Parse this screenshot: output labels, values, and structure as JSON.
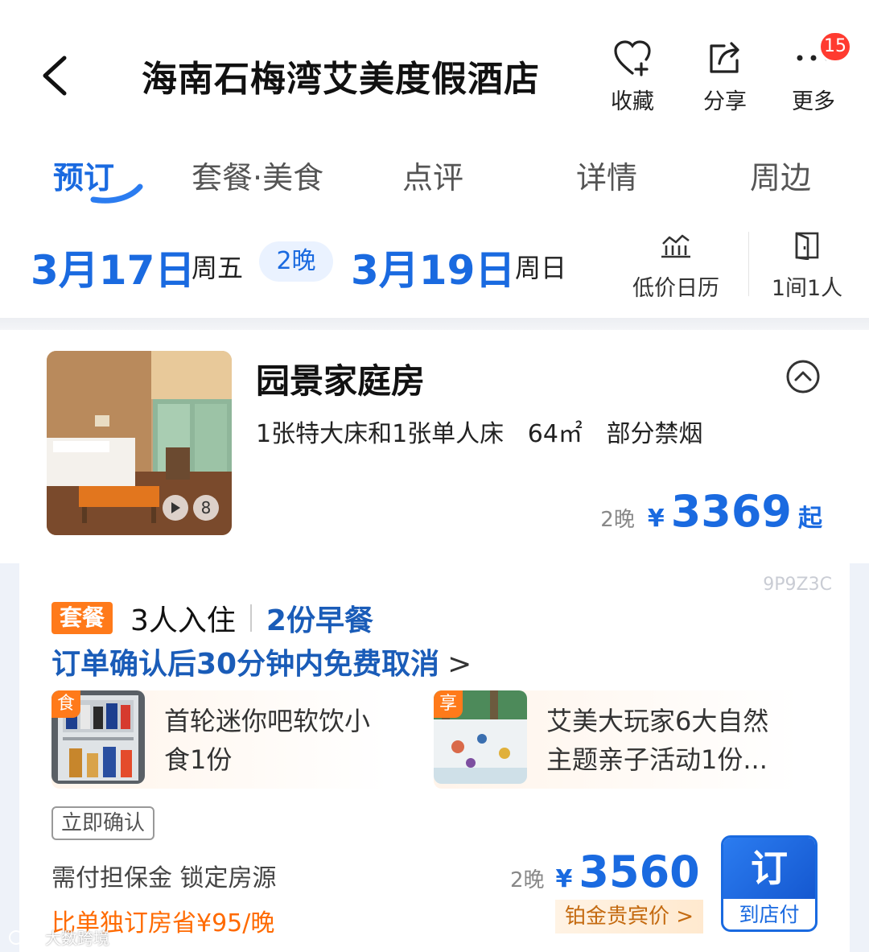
{
  "header": {
    "title": "海南石梅湾艾美度假酒店",
    "actions": [
      {
        "label": "收藏",
        "icon": "heart-plus-icon"
      },
      {
        "label": "分享",
        "icon": "share-icon"
      },
      {
        "label": "更多",
        "icon": "more-icon"
      }
    ],
    "badge_count": "15"
  },
  "tabs": [
    {
      "label": "预订",
      "active": true
    },
    {
      "label": "套餐·美食",
      "active": false
    },
    {
      "label": "点评",
      "active": false
    },
    {
      "label": "详情",
      "active": false
    },
    {
      "label": "周边",
      "active": false
    }
  ],
  "dates": {
    "checkin": "3月17日",
    "checkin_week": "周五",
    "nights": "2晚",
    "checkout": "3月19日",
    "checkout_week": "周日"
  },
  "tools": [
    {
      "label": "低价日历",
      "icon": "price-chart-icon"
    },
    {
      "label": "1间1人",
      "icon": "door-icon"
    }
  ],
  "room": {
    "name": "园景家庭房",
    "specs": [
      "1张特大床和1张单人床",
      "64㎡",
      "部分禁烟"
    ],
    "photo_count": "8",
    "price_nights": "2晚",
    "currency": "¥",
    "price": "3369",
    "price_suffix": "起"
  },
  "package": {
    "code": "9P9Z3C",
    "tag": "套餐",
    "guests": "3人入住",
    "breakfast": "2份早餐",
    "cancel_policy": "订单确认后30分钟内免费取消",
    "perks": [
      {
        "corner": "食",
        "text_line1": "首轮迷你吧软饮小",
        "text_line2": "食1份"
      },
      {
        "corner": "享",
        "text_line1": "艾美大玩家6大自然",
        "text_line2": "主题亲子活动1份..."
      }
    ],
    "instant_confirm": "立即确认",
    "deposit_note": "需付担保金 锁定房源",
    "save_note": "比单独订房省¥95/晚",
    "price_nights": "2晚",
    "currency": "¥",
    "price": "3560",
    "vip_label": "铂金贵宾价",
    "book_label": "订",
    "book_sub": "到店付"
  },
  "watermark": "大数跨境",
  "colors": {
    "accent_blue": "#1a6ae0",
    "orange": "#ff7a1a",
    "badge_red": "#ff3b30"
  }
}
